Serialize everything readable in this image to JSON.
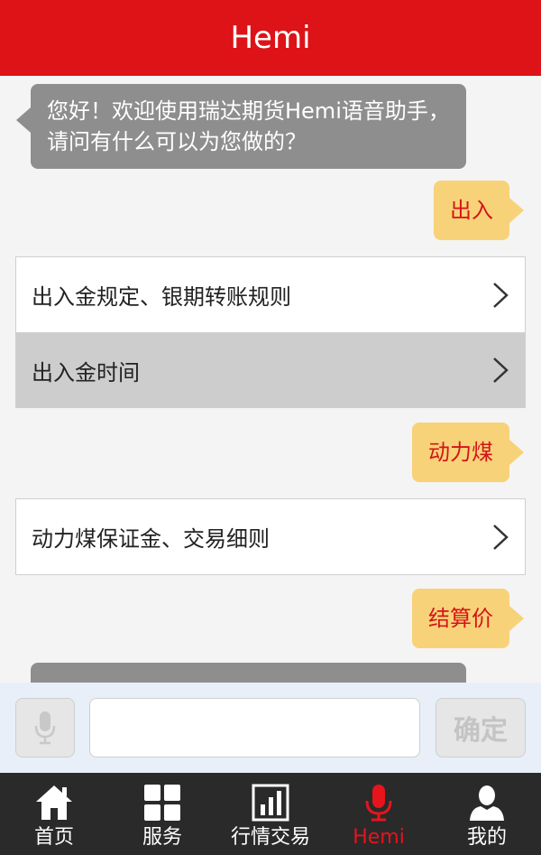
{
  "header": {
    "title": "Hemi"
  },
  "chat": {
    "greeting": "您好！欢迎使用瑞达期货Hemi语音助手，请问有什么可以为您做的？",
    "query_1": "出入",
    "options_1": [
      "出入金规定、银期转账规则",
      "出入金时间"
    ],
    "query_2": "动力煤",
    "options_2": [
      "动力煤保证金、交易细则"
    ],
    "query_3": "结算价"
  },
  "input": {
    "placeholder": "",
    "confirm_label": "确定"
  },
  "tabs": [
    {
      "label": "首页",
      "icon": "home-icon"
    },
    {
      "label": "服务",
      "icon": "grid-icon"
    },
    {
      "label": "行情交易",
      "icon": "chart-icon"
    },
    {
      "label": "Hemi",
      "icon": "microphone-icon"
    },
    {
      "label": "我的",
      "icon": "user-icon"
    }
  ],
  "colors": {
    "header": "#dd1317",
    "user_bubble": "#f8d278",
    "bot_bubble": "#8e8e8e",
    "active_tab": "#e6141b",
    "tabbar": "#2a2a2a"
  }
}
